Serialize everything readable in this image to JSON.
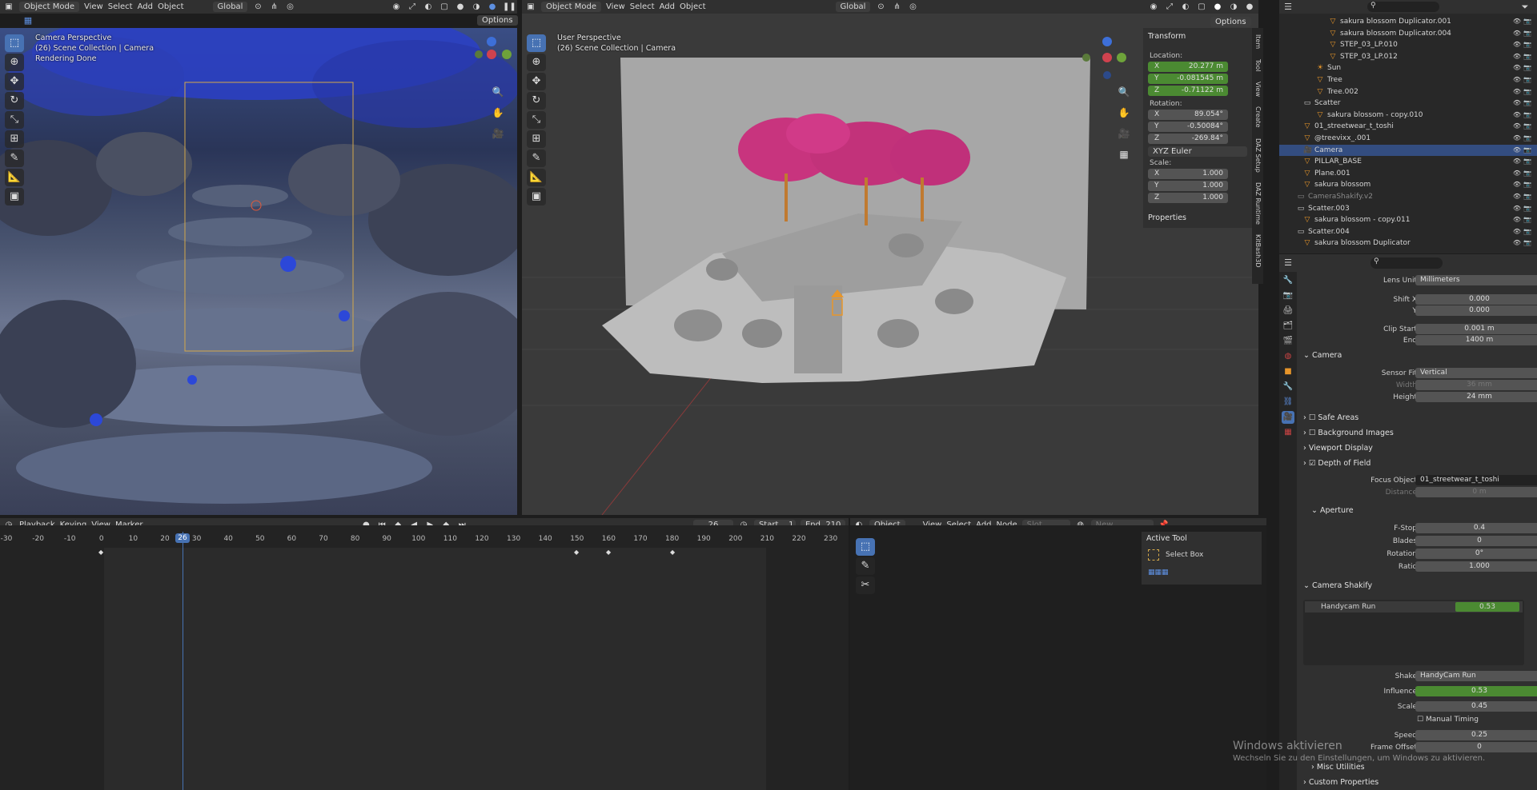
{
  "left_vp": {
    "mode": "Object Mode",
    "menus": [
      "View",
      "Select",
      "Add",
      "Object"
    ],
    "orientation": "Global",
    "options": "Options",
    "overlay": [
      "Camera Perspective",
      "(26) Scene Collection | Camera",
      "Rendering Done"
    ]
  },
  "right_vp": {
    "mode": "Object Mode",
    "menus": [
      "View",
      "Select",
      "Add",
      "Object"
    ],
    "orientation": "Global",
    "options": "Options",
    "overlay": [
      "User Perspective",
      "(26) Scene Collection | Camera"
    ]
  },
  "npanel": {
    "transform": "Transform",
    "location_label": "Location:",
    "location": [
      {
        "axis": "X",
        "value": "20.277 m"
      },
      {
        "axis": "Y",
        "value": "-0.081545 m"
      },
      {
        "axis": "Z",
        "value": "-0.71122 m"
      }
    ],
    "rotation_label": "Rotation:",
    "rotation": [
      {
        "axis": "X",
        "value": "89.054°"
      },
      {
        "axis": "Y",
        "value": "-0.50084°"
      },
      {
        "axis": "Z",
        "value": "-269.84°"
      }
    ],
    "euler": "XYZ Euler",
    "scale_label": "Scale:",
    "scale": [
      {
        "axis": "X",
        "value": "1.000"
      },
      {
        "axis": "Y",
        "value": "1.000"
      },
      {
        "axis": "Z",
        "value": "1.000"
      }
    ],
    "properties": "Properties",
    "tabs": [
      "Item",
      "Tool",
      "View",
      "Create",
      "DAZ Setup",
      "DAZ Runtime",
      "KitBash3D"
    ]
  },
  "outliner": {
    "rows": [
      "sakura blossom Duplicator.001",
      "sakura blossom Duplicator.004",
      "STEP_03_LP.010",
      "STEP_03_LP.012",
      "Sun",
      "Tree",
      "Tree.002",
      "Scatter",
      "sakura blossom - copy.010",
      "01_streetwear_t_toshi",
      "@treevixx_.001",
      "Camera",
      "PILLAR_BASE",
      "Plane.001",
      "sakura blossom",
      "CameraShakify.v2",
      "Scatter.003",
      "sakura blossom - copy.011",
      "Scatter.004",
      "sakura blossom Duplicator"
    ]
  },
  "props": {
    "lens_unit_label": "Lens Unit",
    "lens_unit": "Millimeters",
    "shift_x_label": "Shift X",
    "shift_x": "0.000",
    "shift_y_label": "Y",
    "shift_y": "0.000",
    "clip_start_label": "Clip Start",
    "clip_start": "0.001 m",
    "clip_end_label": "End",
    "clip_end": "1400 m",
    "camera": "Camera",
    "sensor_fit_label": "Sensor Fit",
    "sensor_fit": "Vertical",
    "width_label": "Width",
    "width": "36 mm",
    "height_label": "Height",
    "height": "24 mm",
    "safe_areas": "Safe Areas",
    "background_images": "Background Images",
    "viewport_display": "Viewport Display",
    "dof": "Depth of Field",
    "focus_object_label": "Focus Object",
    "focus_object": "01_streetwear_t_toshi",
    "distance_label": "Distance",
    "distance": "0 m",
    "aperture": "Aperture",
    "fstop_label": "F-Stop",
    "fstop": "0.4",
    "blades_label": "Blades",
    "blades": "0",
    "rotation_label": "Rotation",
    "rotation": "0°",
    "ratio_label": "Ratio",
    "ratio": "1.000",
    "shakify": "Camera Shakify",
    "shake_item": "Handycam Run",
    "shake_item_val": "0.53",
    "shake_label": "Shake",
    "shake": "HandyCam Run",
    "influence_label": "Influence",
    "influence": "0.53",
    "scale_label": "Scale",
    "scale": "0.45",
    "manual_timing": "Manual Timing",
    "speed_label": "Speed",
    "speed": "0.25",
    "offset_label": "Frame Offset",
    "offset": "0",
    "misc": "Misc Utilities",
    "custom": "Custom Properties"
  },
  "timeline": {
    "menus": [
      "Playback",
      "Keying",
      "View",
      "Marker"
    ],
    "frame": "26",
    "start_label": "Start",
    "start": "1",
    "end_label": "End",
    "end": "210",
    "ticks": [
      "-30",
      "-20",
      "-10",
      "0",
      "10",
      "20",
      "30",
      "40",
      "50",
      "60",
      "70",
      "80",
      "90",
      "100",
      "110",
      "120",
      "130",
      "140",
      "150",
      "160",
      "170",
      "180",
      "190",
      "200",
      "210",
      "220",
      "230"
    ],
    "current": "26"
  },
  "node_editor": {
    "mode": "Object",
    "menus": [
      "View",
      "Select",
      "Add",
      "Node"
    ],
    "slot": "Slot",
    "new": "New",
    "active_tool": "Active Tool",
    "tool_name": "Select Box"
  },
  "watermark": {
    "title": "Windows aktivieren",
    "sub": "Wechseln Sie zu den Einstellungen, um Windows zu aktivieren."
  }
}
